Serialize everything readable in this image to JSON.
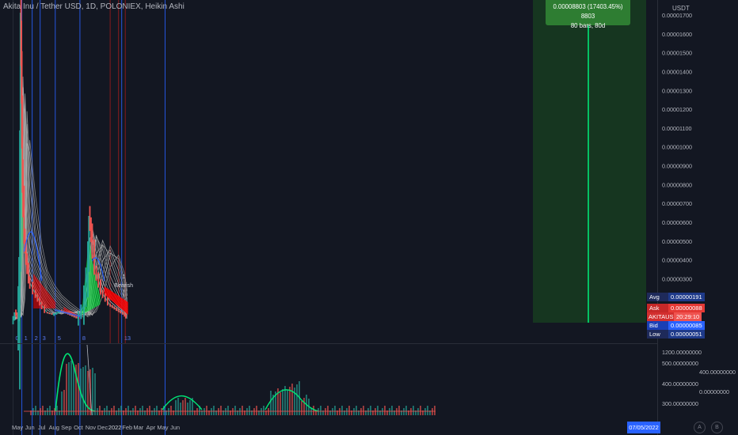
{
  "header": {
    "title": "Akita Inu / Tether USD, 1D, POLONIEX, Heikin Ashi"
  },
  "price_axis": {
    "currency": "USDT",
    "ticks": [
      "0.00001700",
      "0.00001600",
      "0.00001500",
      "0.00001400",
      "0.00001300",
      "0.00001200",
      "0.00001100",
      "0.00001000",
      "0.00000900",
      "0.00000800",
      "0.00000700",
      "0.00000600",
      "0.00000500",
      "0.00000400",
      "0.00000300"
    ]
  },
  "volume_axis": {
    "ticks": [
      "1200.00000000",
      "500.00000000",
      "400.00000000",
      "300.00000000"
    ],
    "right_ticks": [
      "400.00000000",
      "0.00000000"
    ]
  },
  "badges": {
    "avg": {
      "label": "Avg",
      "value": "0.00000191"
    },
    "ask": {
      "label": "Ask",
      "value": "0.00000088"
    },
    "symbol": {
      "label": "AKITAUSDT",
      "value": "20:29:10"
    },
    "bid": {
      "label": "Bid",
      "value": "0.00000085"
    },
    "low": {
      "label": "Low",
      "value": "0.00000051"
    }
  },
  "measure_box": {
    "line1": "0.00008803 (17403.45%) 8803",
    "line2": "80 bars, 80d"
  },
  "annotations": {
    "bearish_count": "1",
    "bearish_label": "Bearish",
    "wave_labels": [
      "0",
      "1",
      "2",
      "3",
      "5",
      "8",
      "13"
    ]
  },
  "time_axis": {
    "ticks": [
      "May",
      "Jun",
      "Jul",
      "Aug",
      "Sep",
      "Oct",
      "Nov",
      "Dec",
      "2022",
      "Feb",
      "Mar",
      "Apr",
      "May",
      "Jun"
    ],
    "current_date": "07/05/2022"
  },
  "corner_buttons": {
    "a": "A",
    "b": "B"
  },
  "colors": {
    "background": "#131722",
    "up": "#26a69a",
    "down": "#ef5350",
    "ribbon_red": "#ff0000",
    "ribbon_green": "#00ff3c",
    "fib_line": "#2962ff",
    "fib_red": "#b71c1c",
    "measure_bg": "#1b5e20",
    "measure_line": "#00e676",
    "vol_osc": "#00e676"
  },
  "chart_data": [
    {
      "type": "line",
      "title": "Akita Inu / Tether USD, 1D, POLONIEX, Heikin Ashi",
      "ylabel": "USDT",
      "ylim": [
        5e-07,
        1.72e-05
      ],
      "x_ticks": [
        "May",
        "Jun",
        "Jul",
        "Aug",
        "Sep",
        "Oct",
        "Nov",
        "Dec",
        "2022",
        "Feb"
      ],
      "series": [
        {
          "values": [
            {
              "x": "2021-04-20",
              "y": 8e-07
            },
            {
              "x": "2021-04-27",
              "y": 1.2e-06
            },
            {
              "x": "2021-05-03",
              "y": 9e-07
            },
            {
              "x": "2021-05-07",
              "y": 4e-06
            },
            {
              "x": "2021-05-10",
              "y": 1.65e-05
            },
            {
              "x": "2021-05-12",
              "y": 1.25e-05
            },
            {
              "x": "2021-05-15",
              "y": 7.8e-06
            },
            {
              "x": "2021-05-20",
              "y": 5e-06
            },
            {
              "x": "2021-05-25",
              "y": 3.8e-06
            },
            {
              "x": "2021-06-01",
              "y": 2.8e-06
            },
            {
              "x": "2021-06-15",
              "y": 2.2e-06
            },
            {
              "x": "2021-07-01",
              "y": 1.6e-06
            },
            {
              "x": "2021-07-15",
              "y": 1.2e-06
            },
            {
              "x": "2021-08-01",
              "y": 1.1e-06
            },
            {
              "x": "2021-08-20",
              "y": 1.3e-06
            },
            {
              "x": "2021-09-10",
              "y": 1.1e-06
            },
            {
              "x": "2021-10-01",
              "y": 9e-07
            },
            {
              "x": "2021-10-15",
              "y": 1.6e-06
            },
            {
              "x": "2021-10-25",
              "y": 3.5e-06
            },
            {
              "x": "2021-10-30",
              "y": 6.2e-06
            },
            {
              "x": "2021-11-05",
              "y": 5e-06
            },
            {
              "x": "2021-11-15",
              "y": 3.3e-06
            },
            {
              "x": "2021-12-01",
              "y": 2.2e-06
            },
            {
              "x": "2021-12-20",
              "y": 1.6e-06
            },
            {
              "x": "2022-01-10",
              "y": 1.3e-06
            },
            {
              "x": "2022-01-25",
              "y": 1.1e-06
            },
            {
              "x": "2022-02-01",
              "y": 9e-07
            }
          ]
        }
      ]
    }
  ]
}
